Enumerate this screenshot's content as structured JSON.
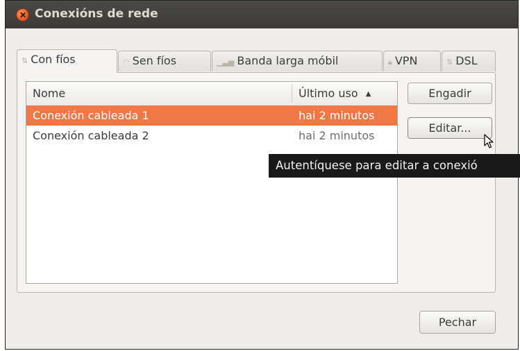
{
  "window": {
    "title": "Conexións de rede"
  },
  "tabs": [
    {
      "label": "Con fíos",
      "icon": "wired-network-icon",
      "active": true
    },
    {
      "label": "Sen fíos",
      "icon": "wifi-icon",
      "active": false
    },
    {
      "label": "Banda larga móbil",
      "icon": "mobile-signal-icon",
      "active": false
    },
    {
      "label": "VPN",
      "icon": "lock-icon",
      "active": false
    },
    {
      "label": "DSL",
      "icon": "dsl-icon",
      "active": false
    }
  ],
  "connections_list": {
    "columns": {
      "name": "Nome",
      "last_used": "Último uso"
    },
    "sort_indicator": "▲",
    "rows": [
      {
        "name": "Conexión cableada 1",
        "last_used": "hai 2 minutos",
        "selected": true
      },
      {
        "name": "Conexión cableada 2",
        "last_used": "hai 2 minutos",
        "selected": false
      }
    ]
  },
  "buttons": {
    "add": "Engadir",
    "edit": "Editar...",
    "close": "Pechar"
  },
  "tooltip": "Autentíquese para editar a conexió",
  "colors": {
    "selection": "#f07746",
    "titlebar": "#3f3e3b",
    "window_bg": "#eeedea"
  }
}
